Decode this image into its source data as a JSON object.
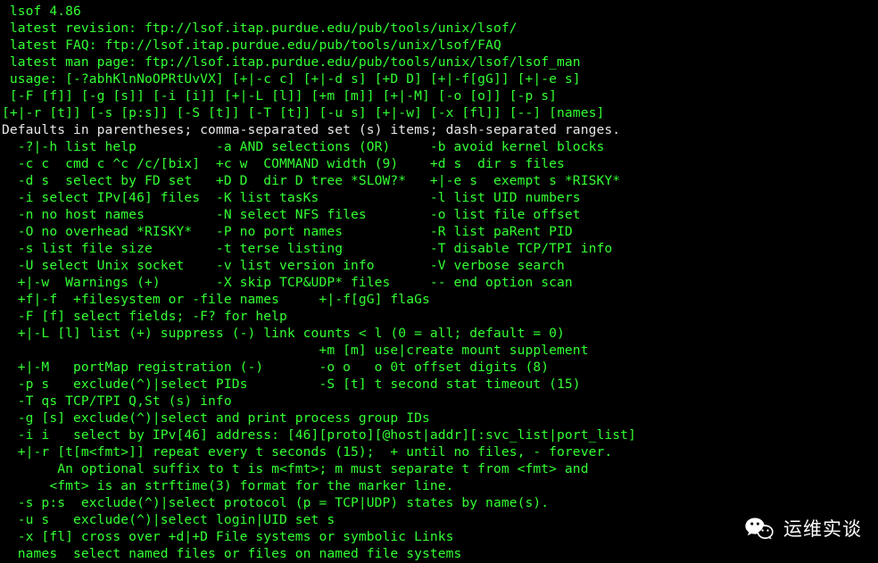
{
  "colors": {
    "bg": "#000000",
    "fg": "#33ff33",
    "highlight": "#e6e6e6"
  },
  "watermark": {
    "text": "运维实谈",
    "icon": "wechat-icon"
  },
  "lines": [
    " lsof 4.86",
    " latest revision: ftp://lsof.itap.purdue.edu/pub/tools/unix/lsof/",
    " latest FAQ: ftp://lsof.itap.purdue.edu/pub/tools/unix/lsof/FAQ",
    " latest man page: ftp://lsof.itap.purdue.edu/pub/tools/unix/lsof/lsof_man",
    " usage: [-?abhKlnNoOPRtUvVX] [+|-c c] [+|-d s] [+D D] [+|-f[gG]] [+|-e s]",
    " [-F [f]] [-g [s]] [-i [i]] [+|-L [l]] [+m [m]] [+|-M] [-o [o]] [-p s]",
    "[+|-r [t]] [-s [p:s]] [-S [t]] [-T [t]] [-u s] [+|-w] [-x [fl]] [--] [names]",
    "Defaults in parentheses; comma-separated set (s) items; dash-separated ranges.",
    "  -?|-h list help          -a AND selections (OR)     -b avoid kernel blocks",
    "  -c c  cmd c ^c /c/[bix]  +c w  COMMAND width (9)    +d s  dir s files",
    "  -d s  select by FD set   +D D  dir D tree *SLOW?*   +|-e s  exempt s *RISKY*",
    "  -i select IPv[46] files  -K list tasKs              -l list UID numbers",
    "  -n no host names         -N select NFS files        -o list file offset",
    "  -O no overhead *RISKY*   -P no port names           -R list paRent PID",
    "  -s list file size        -t terse listing           -T disable TCP/TPI info",
    "  -U select Unix socket    -v list version info       -V verbose search",
    "  +|-w  Warnings (+)       -X skip TCP&UDP* files     -- end option scan",
    "  +f|-f  +filesystem or -file names     +|-f[gG] flaGs ",
    "  -F [f] select fields; -F? for help  ",
    "  +|-L [l] list (+) suppress (-) link counts < l (0 = all; default = 0)",
    "                                        +m [m] use|create mount supplement",
    "  +|-M   portMap registration (-)       -o o   o 0t offset digits (8)",
    "  -p s   exclude(^)|select PIDs         -S [t] t second stat timeout (15)",
    "  -T qs TCP/TPI Q,St (s) info",
    "  -g [s] exclude(^)|select and print process group IDs",
    "  -i i   select by IPv[46] address: [46][proto][@host|addr][:svc_list|port_list]",
    "  +|-r [t[m<fmt>]] repeat every t seconds (15);  + until no files, - forever.",
    "       An optional suffix to t is m<fmt>; m must separate t from <fmt> and",
    "      <fmt> is an strftime(3) format for the marker line.",
    "  -s p:s  exclude(^)|select protocol (p = TCP|UDP) states by name(s).",
    "  -u s   exclude(^)|select login|UID set s",
    "  -x [fl] cross over +d|+D File systems or symbolic Links",
    "  names  select named files or files on named file systems"
  ],
  "white_line_indices": [
    7
  ]
}
